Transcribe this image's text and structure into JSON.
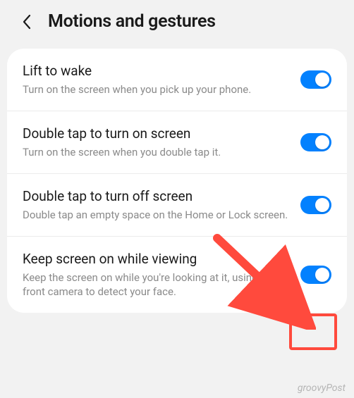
{
  "header": {
    "title": "Motions and gestures"
  },
  "settings": [
    {
      "title": "Lift to wake",
      "desc": "Turn on the screen when you pick up your phone.",
      "on": true
    },
    {
      "title": "Double tap to turn on screen",
      "desc": "Turn on the screen when you double tap it.",
      "on": true
    },
    {
      "title": "Double tap to turn off screen",
      "desc": "Double tap an empty space on the Home or Lock screen.",
      "on": true
    },
    {
      "title": "Keep screen on while viewing",
      "desc": "Keep the screen on while you're looking at it, using the front camera to detect your face.",
      "on": true
    }
  ],
  "watermark": "groovyPost"
}
